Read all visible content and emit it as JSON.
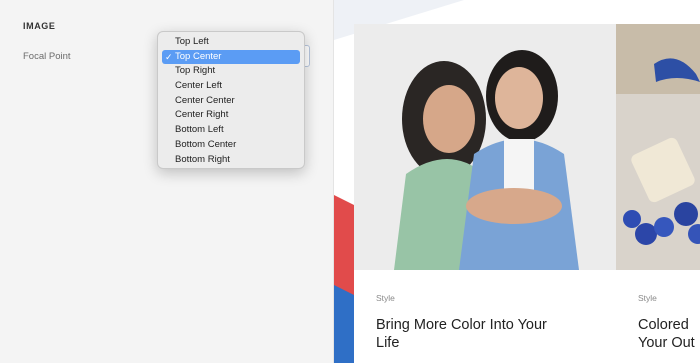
{
  "settings": {
    "section_title": "IMAGE",
    "focal_point_label": "Focal Point"
  },
  "focal_point_menu": {
    "options": [
      "Top Left",
      "Top Center",
      "Top Right",
      "Center Left",
      "Center Center",
      "Center Right",
      "Bottom Left",
      "Bottom Center",
      "Bottom Right"
    ],
    "selected": "Top Center",
    "check_glyph": "✓"
  },
  "preview": {
    "cards": [
      {
        "category": "Style",
        "title_line1": "Bring More Color Into Your",
        "title_line2": "Life"
      },
      {
        "category": "Style",
        "title_line1": "Colored",
        "title_line2": "Your Out"
      }
    ]
  },
  "colors": {
    "menu_selection": "#5b9cf4",
    "accent_red": "#e14b4b",
    "accent_blue": "#2f6fc6"
  }
}
